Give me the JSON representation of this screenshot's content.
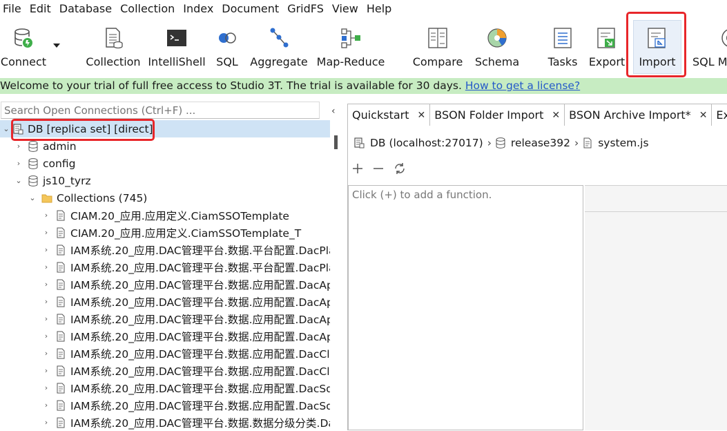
{
  "menu": [
    "File",
    "Edit",
    "Database",
    "Collection",
    "Index",
    "Document",
    "GridFS",
    "View",
    "Help"
  ],
  "toolbar": {
    "connect": "Connect",
    "collection": "Collection",
    "intellishell": "IntelliShell",
    "sql": "SQL",
    "aggregate": "Aggregate",
    "mapreduce": "Map-Reduce",
    "compare": "Compare",
    "schema": "Schema",
    "tasks": "Tasks",
    "export": "Export",
    "import": "Import",
    "sqlmigration": "SQL Mi"
  },
  "banner": {
    "text": "Welcome to your trial of full free access to Studio 3T. The trial is available for 30 days. ",
    "link": "How to get a license?"
  },
  "search": {
    "placeholder": "Search Open Connections (Ctrl+F) ..."
  },
  "tree": {
    "root": "DB [replica set] [direct]",
    "databases": [
      "admin",
      "config",
      "js10_tyrz"
    ],
    "collections_folder": "Collections (745)",
    "collections": [
      "CIAM.20_应用.应用定义.CiamSSOTemplate",
      "CIAM.20_应用.应用定义.CiamSSOTemplate_T",
      "IAM系统.20_应用.DAC管理平台.数据.平台配置.DacPlatf",
      "IAM系统.20_应用.DAC管理平台.数据.平台配置.DacPlatf",
      "IAM系统.20_应用.DAC管理平台.数据.应用配置.DacApp",
      "IAM系统.20_应用.DAC管理平台.数据.应用配置.DacApp",
      "IAM系统.20_应用.DAC管理平台.数据.应用配置.DacApp",
      "IAM系统.20_应用.DAC管理平台.数据.应用配置.DacApp",
      "IAM系统.20_应用.DAC管理平台.数据.应用配置.DacClien",
      "IAM系统.20_应用.DAC管理平台.数据.应用配置.DacClien",
      "IAM系统.20_应用.DAC管理平台.数据.应用配置.DacSdkC",
      "IAM系统.20_应用.DAC管理平台.数据.应用配置.DacSdkC",
      "IAM系统.20_应用.DAC管理平台.数据.数据分级分类.Dac"
    ]
  },
  "tabs": [
    "Quickstart",
    "BSON Folder Import",
    "BSON Archive Import*",
    "Export*"
  ],
  "breadcrumb": {
    "connection": "DB (localhost:27017)",
    "database": "release392",
    "file": "system.js"
  },
  "functions": {
    "empty_hint": "Click (+) to add a function."
  },
  "colors": {
    "highlight": "#e8262a",
    "banner_bg": "#c7ecc2",
    "link": "#2459c9",
    "selection": "#cfe3f5"
  }
}
